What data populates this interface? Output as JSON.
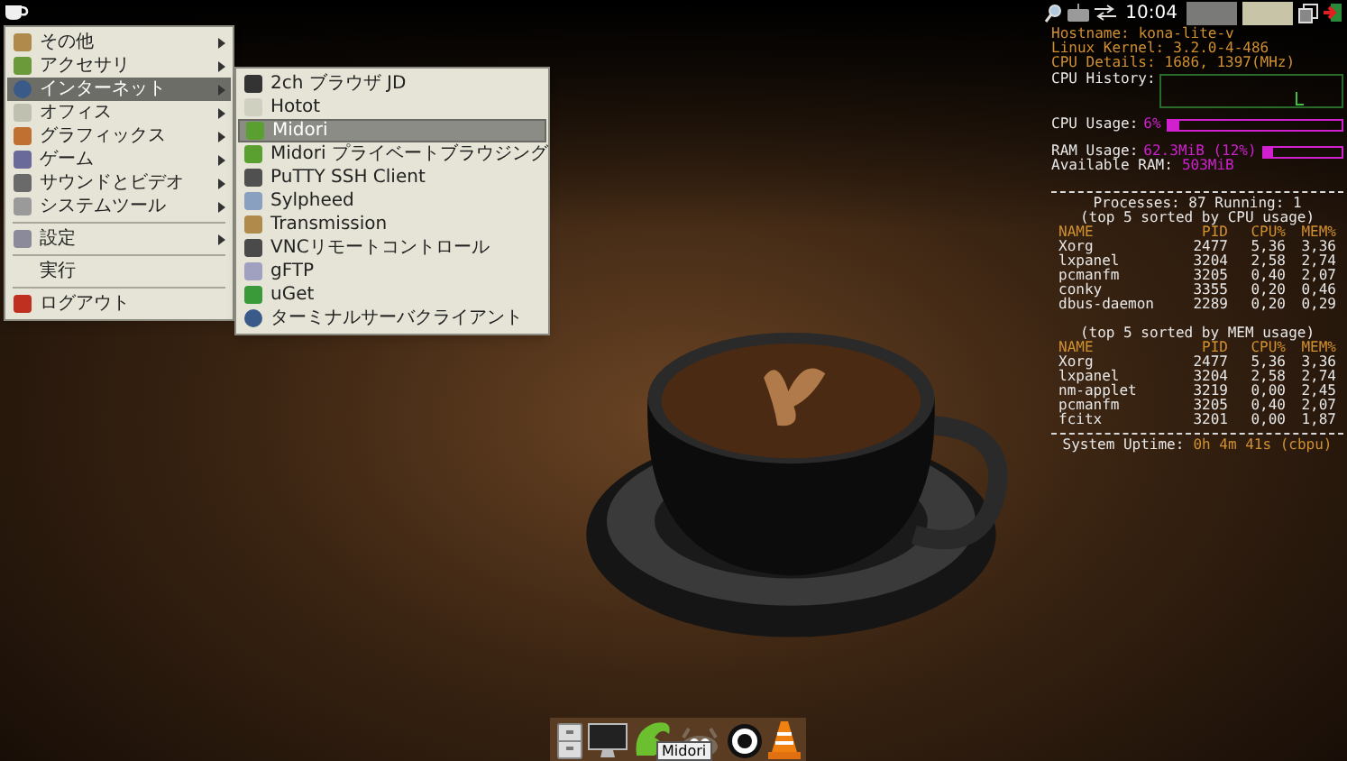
{
  "top_panel": {
    "clock": "10:04",
    "workspaces": [
      {
        "selected": false
      },
      {
        "selected": true
      }
    ]
  },
  "menu": {
    "items": [
      {
        "kind": "submenu",
        "label": "その他",
        "selected": false
      },
      {
        "kind": "submenu",
        "label": "アクセサリ",
        "selected": false
      },
      {
        "kind": "submenu",
        "label": "インターネット",
        "selected": true
      },
      {
        "kind": "submenu",
        "label": "オフィス",
        "selected": false
      },
      {
        "kind": "submenu",
        "label": "グラフィックス",
        "selected": false
      },
      {
        "kind": "submenu",
        "label": "ゲーム",
        "selected": false
      },
      {
        "kind": "submenu",
        "label": "サウンドとビデオ",
        "selected": false
      },
      {
        "kind": "submenu",
        "label": "システムツール",
        "selected": false
      },
      {
        "kind": "separator"
      },
      {
        "kind": "submenu",
        "label": "設定",
        "selected": false
      },
      {
        "kind": "separator"
      },
      {
        "kind": "action",
        "label": "実行",
        "selected": false
      },
      {
        "kind": "separator"
      },
      {
        "kind": "action",
        "label": "ログアウト",
        "selected": false
      }
    ]
  },
  "submenu": {
    "items": [
      {
        "label": "2ch ブラウザ JD",
        "selected": false
      },
      {
        "label": "Hotot",
        "selected": false
      },
      {
        "label": "Midori",
        "selected": true
      },
      {
        "label": "Midori プライベートブラウジング",
        "selected": false
      },
      {
        "label": "PuTTY SSH Client",
        "selected": false
      },
      {
        "label": "Sylpheed",
        "selected": false
      },
      {
        "label": "Transmission",
        "selected": false
      },
      {
        "label": "VNCリモートコントロール",
        "selected": false
      },
      {
        "label": "gFTP",
        "selected": false
      },
      {
        "label": "uGet",
        "selected": false
      },
      {
        "label": "ターミナルサーバクライアント",
        "selected": false
      }
    ]
  },
  "conky": {
    "info": [
      {
        "kind": "info",
        "label": "Hostname:",
        "value": "kona-lite-v"
      },
      {
        "kind": "info",
        "label": "Linux Kernel:",
        "value": "3.2.0-4-486"
      },
      {
        "kind": "info",
        "label": "CPU Details:",
        "value": "1686, 1397(MHz)"
      }
    ],
    "cpu_history": {
      "label": "CPU History:"
    },
    "cpu_usage": {
      "label": "CPU Usage:",
      "value": "6%",
      "level": 0.06
    },
    "ram_usage": {
      "label": "RAM Usage:",
      "value": "62.3MiB (12%)",
      "level": 0.12
    },
    "available_ram": {
      "label": "Available RAM:",
      "value": "503MiB"
    },
    "processes": "Processes: 87  Running: 1",
    "tables": [
      {
        "title": "(top 5 sorted by CPU usage)",
        "columns": [
          "NAME",
          "PID",
          "CPU%",
          "MEM%"
        ],
        "rows": [
          [
            "Xorg",
            "2477",
            "5,36",
            "3,36"
          ],
          [
            "lxpanel",
            "3204",
            "2,58",
            "2,74"
          ],
          [
            "pcmanfm",
            "3205",
            "0,40",
            "2,07"
          ],
          [
            "conky",
            "3355",
            "0,20",
            "0,46"
          ],
          [
            "dbus-daemon",
            "2289",
            "0,20",
            "0,29"
          ]
        ]
      },
      {
        "title": "(top 5 sorted by MEM usage)",
        "columns": [
          "NAME",
          "PID",
          "CPU%",
          "MEM%"
        ],
        "rows": [
          [
            "Xorg",
            "2477",
            "5,36",
            "3,36"
          ],
          [
            "lxpanel",
            "3204",
            "2,58",
            "2,74"
          ],
          [
            "nm-applet",
            "3219",
            "0,00",
            "2,45"
          ],
          [
            "pcmanfm",
            "3205",
            "0,40",
            "2,07"
          ],
          [
            "fcitx",
            "3201",
            "0,00",
            "1,87"
          ]
        ]
      }
    ],
    "uptime": {
      "label": "System Uptime:",
      "value": "0h 4m 41s (cbpu)"
    }
  },
  "dock": {
    "items": [
      {
        "kind": "files"
      },
      {
        "kind": "monitor"
      },
      {
        "kind": "browser"
      },
      {
        "kind": "gimp"
      },
      {
        "kind": "circle"
      },
      {
        "kind": "cone"
      }
    ],
    "tooltip": "Midori"
  }
}
